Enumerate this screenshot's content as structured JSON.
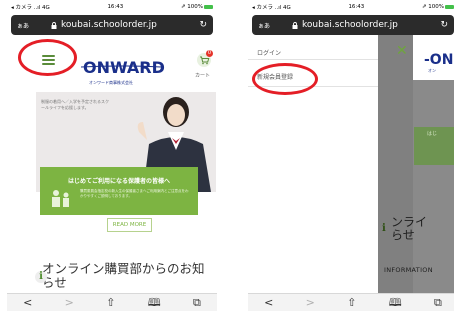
{
  "status_left": {
    "carrier": "◂ カメラ ..ıl 4G",
    "time": "16:43",
    "battery": "⇗ 100%"
  },
  "status_right": {
    "carrier": "◂ カメラ ..ıl 4G",
    "time": "16:43",
    "battery": "⇗ 100%"
  },
  "url_left": {
    "aa": "ぁあ",
    "domain": "koubai.schoolorder.jp"
  },
  "url_right": {
    "aa": "ぁあ",
    "domain": "koubai.schoolorder.jp"
  },
  "header": {
    "logo": "ONWARD",
    "logo_sub": "オンワード商事株式会社",
    "cart_label": "カート",
    "cart_count": "0"
  },
  "hero": {
    "text": "制服の着用へ／入学を予定されるスクールライフを応援します。"
  },
  "banner": {
    "title": "はじめてご利用になる保護者の皆様へ",
    "text": "購買委員会指定校の新入生の保護者さまへご利用案内とご注意点をわかりやすくご説明しております。"
  },
  "read_more": "READ MORE",
  "news": {
    "icon": "i",
    "title": "オンライン購買部からのお知らせ"
  },
  "menu": {
    "items": [
      "ログイン",
      "新規会員登録"
    ]
  },
  "right_overlay": {
    "logo_fragment": "-ON",
    "logo_sub": "オン",
    "green_text": "はじ",
    "news_title": "ンライ\nらせ",
    "news_icon": "i",
    "info": "INFORMATION"
  },
  "toolbar": {
    "back": "<",
    "forward": ">",
    "share": "⇧",
    "bookmarks": "🕮",
    "tabs": "⧉"
  }
}
